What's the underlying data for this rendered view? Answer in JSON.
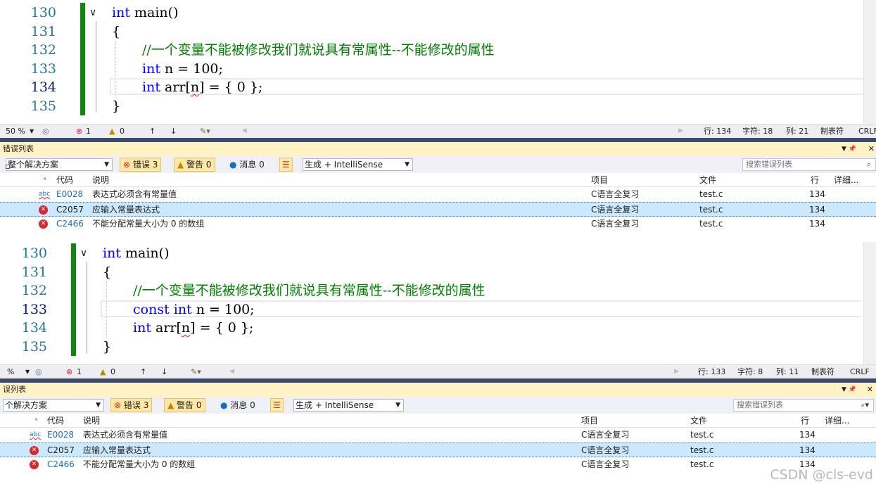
{
  "editor1": {
    "lines": [
      {
        "num": "130",
        "tokens": [
          {
            "t": "int",
            "c": "kw"
          },
          {
            "t": " main()",
            "c": "pl"
          }
        ]
      },
      {
        "num": "131",
        "tokens": [
          {
            "t": "{",
            "c": "pl"
          }
        ]
      },
      {
        "num": "132",
        "tokens": [
          {
            "t": "//一个变量不能被修改我们就说具有常属性--不能修改的属性",
            "c": "cm"
          }
        ]
      },
      {
        "num": "133",
        "tokens": [
          {
            "t": "int",
            "c": "kw"
          },
          {
            "t": " n = 100;",
            "c": "pl"
          }
        ]
      },
      {
        "num": "134",
        "tokens": [
          {
            "t": "int",
            "c": "kw"
          },
          {
            "t": " arr[",
            "c": "pl"
          },
          {
            "t": "n",
            "c": "pl sq"
          },
          {
            "t": "] = { 0 };",
            "c": "pl"
          }
        ]
      },
      {
        "num": "135",
        "tokens": [
          {
            "t": "}",
            "c": "pl"
          }
        ]
      }
    ],
    "status": {
      "zoom": "50 %",
      "errors": "1",
      "warnings": "0",
      "row": "行: 134",
      "char": "字符: 18",
      "col": "列: 21",
      "tab": "制表符",
      "eol": "CRLF"
    }
  },
  "errorlist1": {
    "title": "错误列表",
    "scope": "整个解决方案",
    "errors_btn": "错误 3",
    "warnings_btn": "警告 0",
    "messages_btn": "消息 0",
    "build": "生成 + IntelliSense",
    "search_placeholder": "搜索错误列表",
    "headers": {
      "code": "代码",
      "desc": "说明",
      "project": "项目",
      "file": "文件",
      "line": "行",
      "detail": "详细..."
    },
    "rows": [
      {
        "code": "E0028",
        "desc": "表达式必须含有常量值",
        "project": "C语言全复习",
        "file": "test.c",
        "line": "134"
      },
      {
        "code": "C2057",
        "desc": "应输入常量表达式",
        "project": "C语言全复习",
        "file": "test.c",
        "line": "134"
      },
      {
        "code": "C2466",
        "desc": "不能分配常量大小为 0 的数组",
        "project": "C语言全复习",
        "file": "test.c",
        "line": "134"
      }
    ]
  },
  "editor2": {
    "lines": [
      {
        "num": "130",
        "tokens": [
          {
            "t": "int",
            "c": "kw"
          },
          {
            "t": " main()",
            "c": "pl"
          }
        ]
      },
      {
        "num": "131",
        "tokens": [
          {
            "t": "{",
            "c": "pl"
          }
        ]
      },
      {
        "num": "132",
        "tokens": [
          {
            "t": "//一个变量不能被修改我们就说具有常属性--不能修改的属性",
            "c": "cm"
          }
        ]
      },
      {
        "num": "133",
        "tokens": [
          {
            "t": "const",
            "c": "kw"
          },
          {
            "t": " ",
            "c": "pl"
          },
          {
            "t": "int",
            "c": "kw"
          },
          {
            "t": " n = 100;",
            "c": "pl"
          }
        ]
      },
      {
        "num": "134",
        "tokens": [
          {
            "t": "int",
            "c": "kw"
          },
          {
            "t": " arr[",
            "c": "pl"
          },
          {
            "t": "n",
            "c": "pl sq"
          },
          {
            "t": "] = { 0 };",
            "c": "pl"
          }
        ]
      },
      {
        "num": "135",
        "tokens": [
          {
            "t": "}",
            "c": "pl"
          }
        ]
      }
    ],
    "status": {
      "zoom": "%",
      "errors": "1",
      "warnings": "0",
      "row": "行: 133",
      "char": "字符: 8",
      "col": "列: 11",
      "tab": "制表符",
      "eol": "CRLF"
    }
  },
  "errorlist2": {
    "title": "误列表",
    "scope": "个解决方案",
    "errors_btn": "错误 3",
    "warnings_btn": "警告 0",
    "messages_btn": "消息 0",
    "build": "生成 + IntelliSense",
    "search_placeholder": "搜索错误列表",
    "headers": {
      "code": "代码",
      "desc": "说明",
      "project": "项目",
      "file": "文件",
      "line": "行",
      "detail": "详细..."
    },
    "rows": [
      {
        "code": "E0028",
        "desc": "表达式必须含有常量值",
        "project": "C语言全复习",
        "file": "test.c",
        "line": "134"
      },
      {
        "code": "C2057",
        "desc": "应输入常量表达式",
        "project": "C语言全复习",
        "file": "test.c",
        "line": "134"
      },
      {
        "code": "C2466",
        "desc": "不能分配常量大小为 0 的数组",
        "project": "C语言全复习",
        "file": "test.c",
        "line": "134"
      }
    ]
  },
  "watermark": "CSDN @cls-evd"
}
